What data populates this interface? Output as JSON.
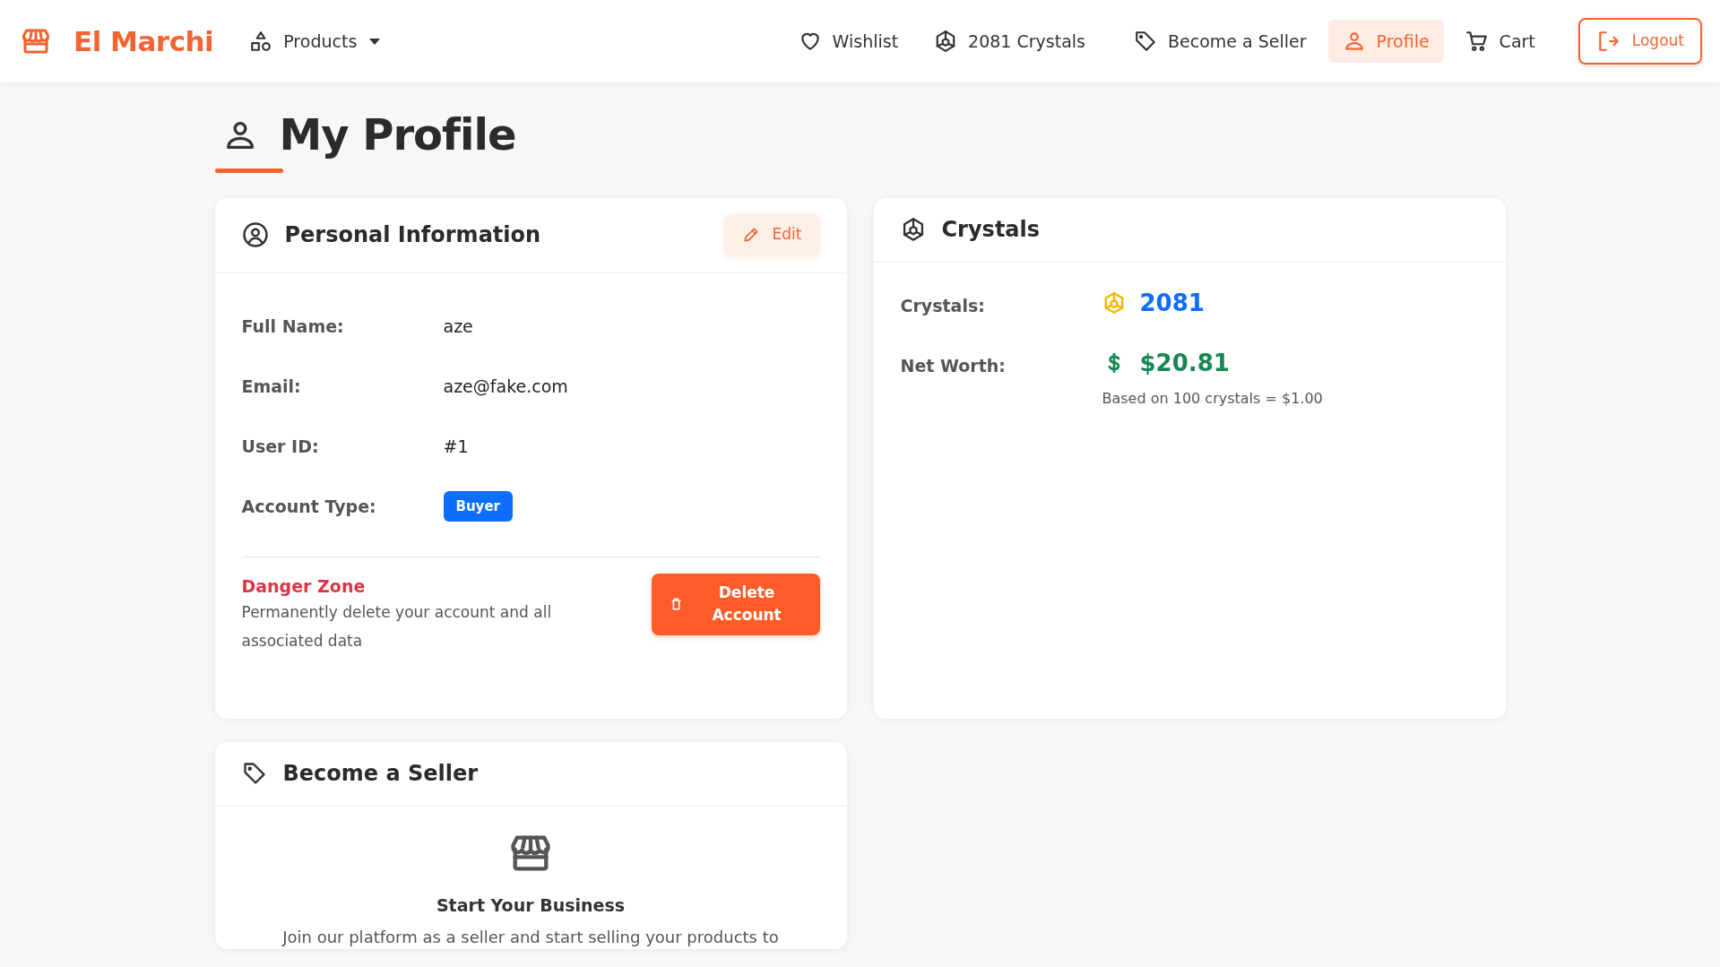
{
  "brand": "El Marchi",
  "nav_left": [
    {
      "label": "Products",
      "kind": "dropdown",
      "selected": false
    }
  ],
  "nav_right": [
    {
      "label": "Wishlist",
      "kind": "heart",
      "selected": false
    },
    {
      "label": "2081 Crystals",
      "kind": "crystal",
      "selected": false
    },
    {
      "label": "Become a Seller",
      "kind": "tag",
      "selected": false
    },
    {
      "label": "Profile",
      "kind": "person",
      "selected": true
    },
    {
      "label": "Cart",
      "kind": "cart",
      "selected": false
    }
  ],
  "logout_button": "Logout",
  "page_title": "My Profile",
  "personal_card": {
    "title": "Personal Information",
    "edit_button": "Edit",
    "fields": [
      {
        "label": "Full Name:",
        "value": "aze",
        "kind": "text"
      },
      {
        "label": "Email:",
        "value": "aze@fake.com",
        "kind": "text"
      },
      {
        "label": "User ID:",
        "value": "#1",
        "kind": "text"
      },
      {
        "label": "Account Type:",
        "value": "Buyer",
        "kind": "badge"
      }
    ],
    "danger_zone": {
      "title": "Danger Zone",
      "description": "Permanently delete your account and all associated data",
      "button": "Delete Account"
    }
  },
  "crystals_card": {
    "title": "Crystals",
    "rows": [
      {
        "label": "Crystals:",
        "value": "2081",
        "kind": "crystals"
      },
      {
        "label": "Net Worth:",
        "value": "$20.81",
        "kind": "money",
        "note": "Based on 100 crystals = $1.00"
      }
    ]
  },
  "seller_card": {
    "title": "Become a Seller",
    "heading": "Start Your Business",
    "text": "Join our platform as a seller and start selling your products to"
  }
}
